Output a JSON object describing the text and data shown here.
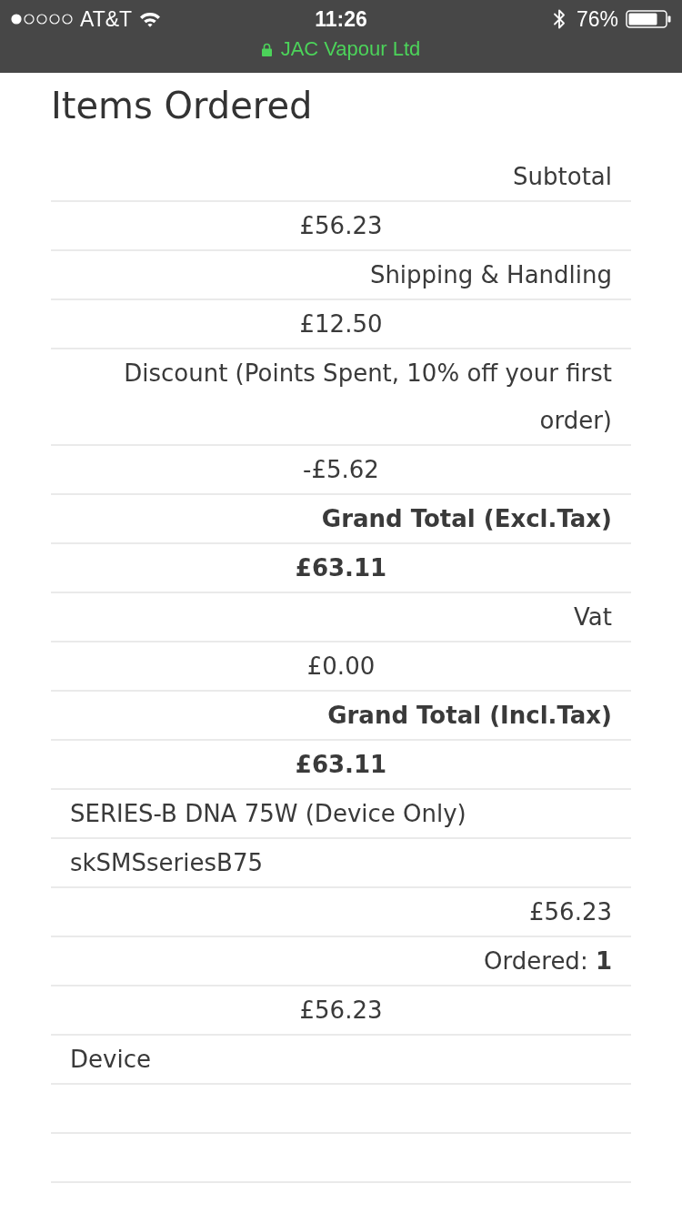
{
  "status_bar": {
    "carrier": "AT&T",
    "time": "11:26",
    "battery": "76%",
    "site": "JAC Vapour Ltd"
  },
  "title": "Items Ordered",
  "rows": [
    {
      "kind": "label",
      "text": "Subtotal"
    },
    {
      "kind": "amount",
      "text": "£56.23"
    },
    {
      "kind": "label",
      "text": "Shipping & Handling"
    },
    {
      "kind": "amount",
      "text": "£12.50"
    },
    {
      "kind": "label",
      "text": "Discount (Points Spent, 10% off your first order)"
    },
    {
      "kind": "amount",
      "text": "-£5.62"
    },
    {
      "kind": "total_label",
      "text": "Grand Total (Excl.Tax)"
    },
    {
      "kind": "total",
      "text": "£63.11"
    },
    {
      "kind": "label",
      "text": "Vat"
    },
    {
      "kind": "amount",
      "text": "£0.00"
    },
    {
      "kind": "total_label",
      "text": "Grand Total (Incl.Tax)"
    },
    {
      "kind": "total",
      "text": "£63.11"
    },
    {
      "kind": "product",
      "text": "SERIES-B DNA 75W (Device Only)"
    },
    {
      "kind": "sku",
      "text": "skSMSseriesB75"
    },
    {
      "kind": "price",
      "text": "£56.23"
    },
    {
      "kind": "quantity",
      "text": "Ordered: **1**"
    },
    {
      "kind": "amount",
      "text": "£56.23"
    },
    {
      "kind": "option",
      "text": "Device"
    },
    {
      "kind": "blank"
    },
    {
      "kind": "blank"
    }
  ]
}
